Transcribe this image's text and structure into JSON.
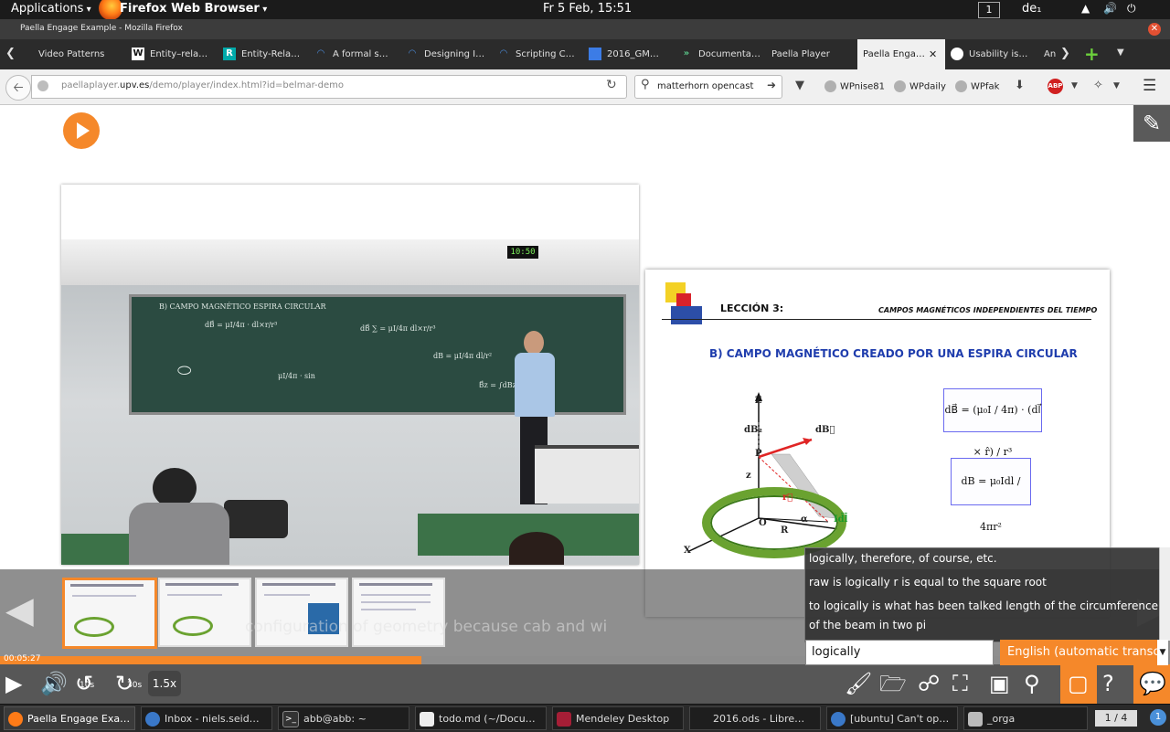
{
  "top_panel": {
    "applications": "Applications",
    "firefox_menu": "Firefox Web Browser",
    "clock": "Fr  5 Feb, 15:51",
    "workspace": "1",
    "language": "de₁"
  },
  "window": {
    "title": "Paella Engage Example - Mozilla Firefox"
  },
  "tabs": [
    {
      "label": "Video Patterns"
    },
    {
      "label": "Entity–rela…",
      "fav": "W"
    },
    {
      "label": "Entity-Rela…",
      "fav": "R"
    },
    {
      "label": "A formal s…"
    },
    {
      "label": "Designing I…"
    },
    {
      "label": "Scripting C…"
    },
    {
      "label": "2016_GM…"
    },
    {
      "label": "Documenta…"
    },
    {
      "label": "Paella Player"
    },
    {
      "label": "Paella Enga…",
      "active": true
    },
    {
      "label": "Usability is…"
    },
    {
      "label": "An"
    }
  ],
  "nav": {
    "url_host": "paellaplayer.",
    "url_domain": "upv.es",
    "url_path": "/demo/player/index.html?id=belmar-demo",
    "search_value": "matterhorn opencast",
    "bookmarks": [
      "WPnise81",
      "WPdaily",
      "WPfak"
    ],
    "abp": "ABP"
  },
  "lecture": {
    "clock": "10:50",
    "chalk_title": "B) CAMPO MAGNÉTICO ESPIRA CIRCULAR"
  },
  "slide": {
    "lesson": "LECCIÓN 3:",
    "header_right": "CAMPOS MAGNÉTICOS INDEPENDIENTES DEL TIEMPO",
    "title": "B) CAMPO MAGNÉTICO CREADO POR UNA ESPIRA CIRCULAR",
    "labels": {
      "z_axis": "Z",
      "dbz": "dB₂",
      "db": "dB⃗",
      "p": "P",
      "z": "z",
      "o": "O",
      "r": "R",
      "idl": "Id̄l̄",
      "x": "X",
      "r_vec": "r⃗",
      "alpha": "α"
    },
    "eq1": "dB⃗ = (μ₀I / 4π) · (dl⃗ × r̂) / r³",
    "eq2": "dB = μ₀Idl / 4πr²"
  },
  "player": {
    "current_time": "00:05:27",
    "progress": 0.36,
    "skip_back": "10s",
    "skip_forward": "30s",
    "speed": "1.5x",
    "subtitle": "configuration of geometry because cab and wi"
  },
  "captions": {
    "results": [
      "logically, therefore, of course, etc.",
      "raw is logically r is equal to the square root",
      "to logically is what has been talked length of the circumference",
      "of the beam in two pi"
    ],
    "search_value": "logically",
    "language": "English (automatic transc"
  },
  "taskbar": {
    "items": [
      {
        "label": "Paella Engage Exa…",
        "active": true
      },
      {
        "label": "Inbox - niels.seid…"
      },
      {
        "label": "abb@abb: ~"
      },
      {
        "label": "todo.md (~/Docu…"
      },
      {
        "label": "Mendeley Desktop"
      },
      {
        "label": "2016.ods - Libre…"
      },
      {
        "label": "[ubuntu] Can't op…"
      },
      {
        "label": "_orga"
      }
    ],
    "pager": "1 / 4",
    "notifications": "1"
  },
  "colors": {
    "accent": "#f5882a",
    "control_bar": "#575757",
    "board": "#2b4b41"
  }
}
